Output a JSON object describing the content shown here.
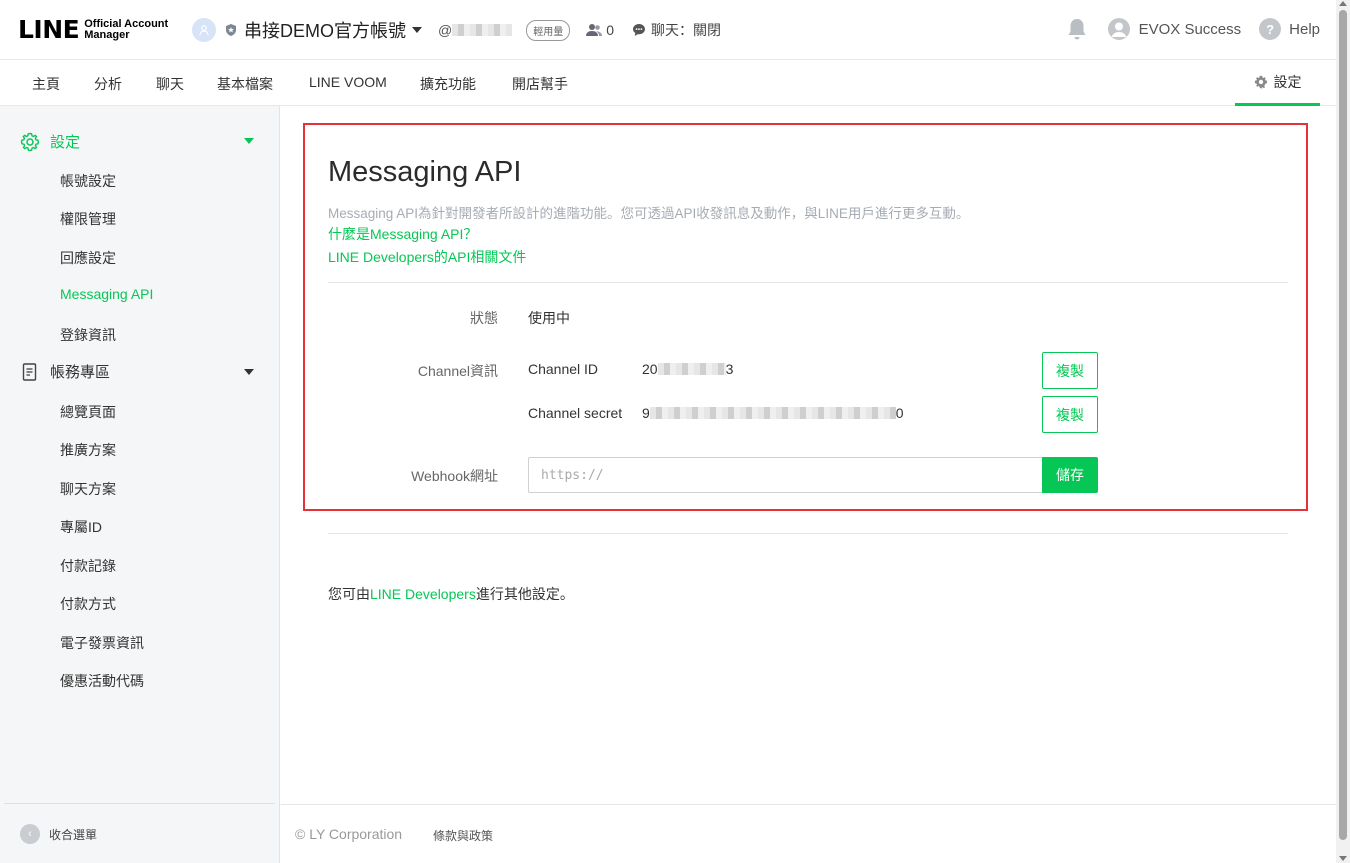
{
  "header": {
    "logo_text": "LINE",
    "logo_sub_1": "Official Account",
    "logo_sub_2": "Manager",
    "account_name": "串接DEMO官方帳號",
    "handle_prefix": "@",
    "plan_badge": "輕用量",
    "friend_count": "0",
    "chat_status": "聊天：關閉",
    "user_name": "EVOX Success",
    "help_label": "Help"
  },
  "nav": {
    "items": [
      "主頁",
      "分析",
      "聊天",
      "基本檔案",
      "LINE VOOM",
      "擴充功能",
      "開店幫手"
    ],
    "settings_label": "設定"
  },
  "sidebar": {
    "group1_label": "設定",
    "group1_items": [
      "帳號設定",
      "權限管理",
      "回應設定",
      "Messaging API",
      "登錄資訊"
    ],
    "group2_label": "帳務專區",
    "group2_items": [
      "總覽頁面",
      "推廣方案",
      "聊天方案",
      "專屬ID",
      "付款記錄",
      "付款方式",
      "電子發票資訊",
      "優惠活動代碼"
    ],
    "collapse_label": "收合選單"
  },
  "main": {
    "title": "Messaging API",
    "description": "Messaging API為針對開發者所設計的進階功能。您可透過API收發訊息及動作，與LINE用戶進行更多互動。",
    "link_what_is": "什麼是Messaging API？",
    "link_docs": "LINE Developers的API相關文件",
    "status_label": "狀態",
    "status_value": "使用中",
    "channel_info_label": "Channel資訊",
    "channel_id_label": "Channel ID",
    "channel_id_start": "20",
    "channel_id_end": "3",
    "channel_secret_label": "Channel secret",
    "channel_secret_start": "9",
    "channel_secret_end": "0",
    "copy_label": "複製",
    "webhook_label": "Webhook網址",
    "webhook_placeholder": "https://",
    "save_label": "儲存",
    "other_prefix": "您可由",
    "other_link": "LINE Developers",
    "other_suffix": "進行其他設定。"
  },
  "footer": {
    "copyright": "© LY Corporation",
    "terms": "條款與政策"
  },
  "colors": {
    "brand_green": "#06c755",
    "highlight_red": "#e53238"
  }
}
